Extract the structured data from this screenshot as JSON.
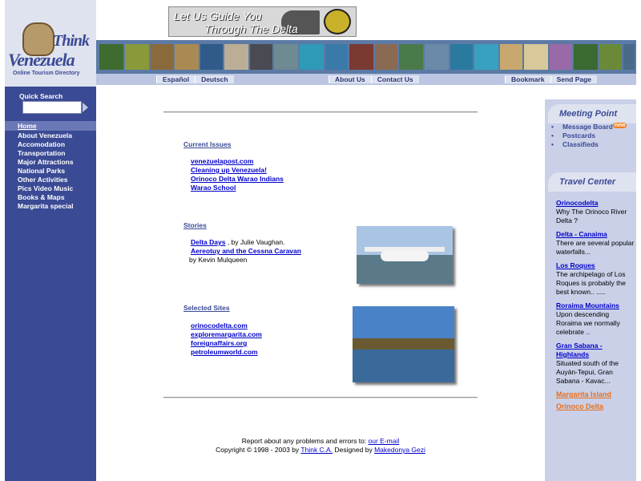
{
  "logo": {
    "think": "Think",
    "venezuela": "Venezuela",
    "tagline": "Online Tourism Directory"
  },
  "banner": {
    "line1": "Let Us Guide You",
    "line2": "Through The Delta"
  },
  "quick_search": {
    "label": "Quick Search",
    "value": ""
  },
  "nav": {
    "home": "Home",
    "items": [
      "About Venezuela",
      "Accomodation",
      "Transportation",
      "Major Attractions",
      "National Parks",
      "Other Activities",
      "Pics Video Music",
      "Books & Maps",
      "Margarita special"
    ]
  },
  "menubar": {
    "lang": [
      "Español",
      "Deutsch"
    ],
    "info": [
      "About Us",
      "Contact Us"
    ],
    "tools": [
      "Bookmark",
      "Send Page"
    ]
  },
  "current_issues": {
    "heading": "Current Issues",
    "links": [
      "venezuelapost.com",
      "Cleaning up Venezuela!",
      "Orinoco Delta Warao Indians",
      "Warao School"
    ]
  },
  "stories": {
    "heading": "Stories",
    "story1_link": "Delta Days",
    "story1_by": " , by Julie Vaughan.",
    "story2_link": "Aereotuy and the Cessna Caravan",
    "story2_by": "by Kevin Mulqueen"
  },
  "selected_sites": {
    "heading": "Selected Sites",
    "links": [
      "orinocodelta.com",
      "exploremargarita.com",
      "foreignaffairs.org",
      "petroleumworld.com"
    ]
  },
  "footer": {
    "line1_prefix": "Report about any problems and errors to: ",
    "email_link": "our E-mail",
    "line2_prefix": "Copyright © 1998 - 2003 by ",
    "think_link": "Think C.A.",
    "designed_by": " Designed by ",
    "designer_link": "Makedonya Gezi"
  },
  "meeting_point": {
    "heading": "Meeting Point",
    "items": [
      "Message Board",
      "Postcards",
      "Classifieds"
    ],
    "badge": "new"
  },
  "travel_center": {
    "heading": "Travel Center",
    "entries": [
      {
        "title": "Orinocodelta",
        "desc": "Why The Orinoco River Delta ?"
      },
      {
        "title": "Delta - Canaima",
        "desc": "There are several popular waterfalls..."
      },
      {
        "title": "Los Roques",
        "desc": "The archipelago of Los Roques is probably the best known.. ....."
      },
      {
        "title": "Roraima Mountains",
        "desc": "Upon descending Roraima we normally celebrate .."
      },
      {
        "title": "Gran Sabana - Highlands",
        "desc": "Situated south of the Auyán-Tepui, Gran Sabana - Kavac..."
      }
    ],
    "extra": [
      "Margarita Island",
      "Orinoco Delta"
    ]
  },
  "colors": {
    "sidebar": "#3a4a94",
    "accent_orange": "#e8701c",
    "link": "#0000cc"
  }
}
